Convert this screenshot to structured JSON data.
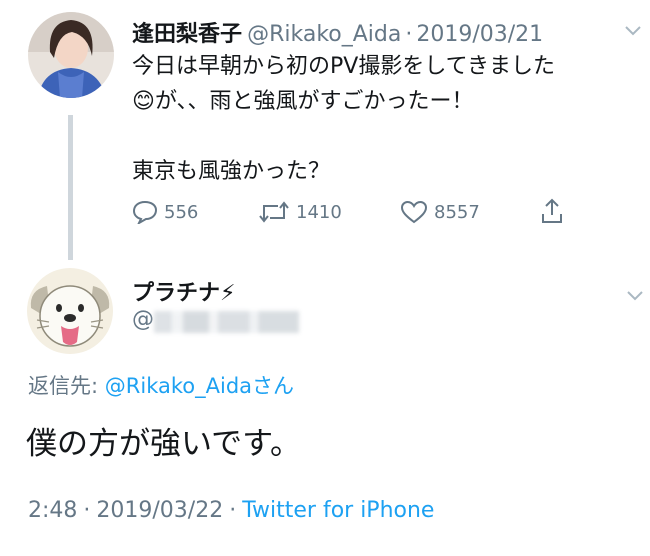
{
  "tweet1": {
    "display_name": "逢田梨香子",
    "handle": "@Rikako_Aida",
    "dot": "·",
    "date": "2019/03/21",
    "line1": "今日は早朝から初のPV撮影をしてきました",
    "line2_emoji": "😊",
    "line2_text": "が、、雨と強風がすごかったー！",
    "line3": "東京も風強かった？",
    "replies": "556",
    "retweets": "1410",
    "likes": "8557"
  },
  "tweet2": {
    "display_name": "プラチナ⚡",
    "handle_prefix": "@",
    "reply_prefix": "返信先: ",
    "reply_handle": "@Rikako_Aida",
    "reply_suffix": "さん",
    "text": "僕の方が強いです。",
    "time": "2:48",
    "sep1": "·",
    "date": "2019/03/22",
    "sep2": "·",
    "source": "Twitter for iPhone"
  },
  "colors": {
    "link": "#1da1f2",
    "muted": "#657786",
    "text": "#14171a",
    "thread_line": "#cfd6dc"
  },
  "icons": [
    "chevron-down-icon",
    "reply-icon",
    "retweet-icon",
    "like-icon",
    "share-icon"
  ]
}
